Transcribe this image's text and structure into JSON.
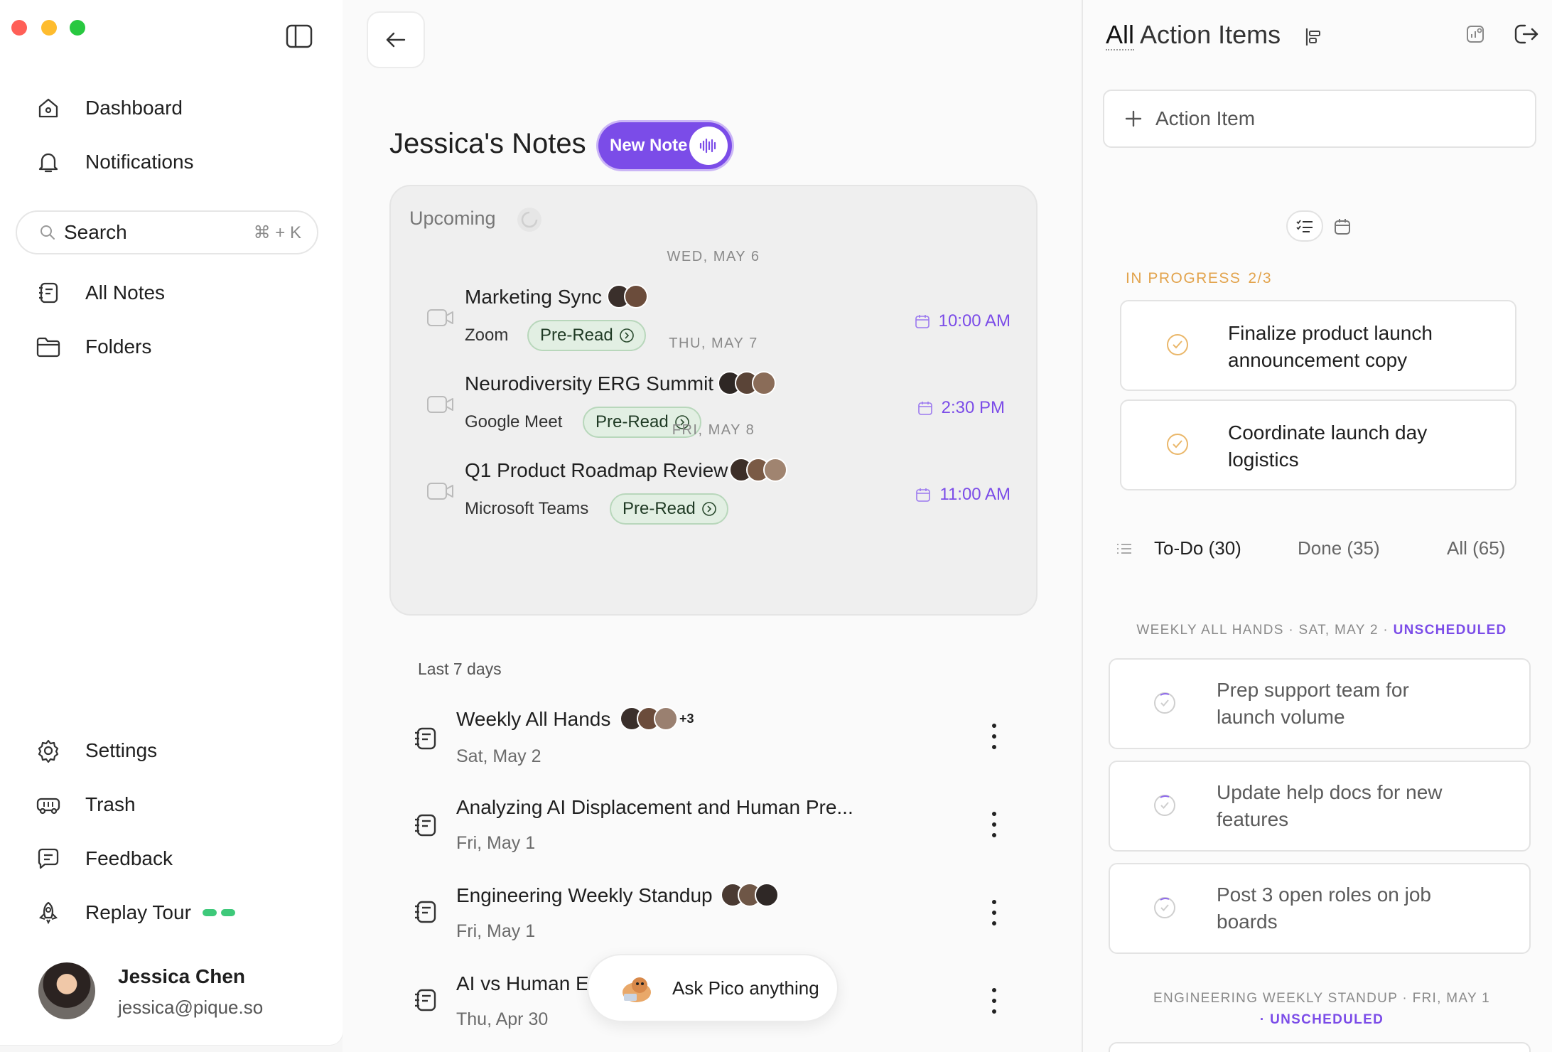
{
  "window_controls": {
    "close_color": "#ff5f57",
    "minimize_color": "#febc2e",
    "zoom_color": "#28c840"
  },
  "sidebar": {
    "nav_top": [
      {
        "label": "Dashboard",
        "icon": "home-icon"
      },
      {
        "label": "Notifications",
        "icon": "bell-icon"
      }
    ],
    "search": {
      "placeholder": "Search",
      "shortcut": "⌘ + K"
    },
    "nav_mid": [
      {
        "label": "All Notes",
        "icon": "notes-icon"
      },
      {
        "label": "Folders",
        "icon": "folder-icon"
      }
    ],
    "nav_bottom": [
      {
        "label": "Settings",
        "icon": "gear-icon"
      },
      {
        "label": "Trash",
        "icon": "trash-icon"
      },
      {
        "label": "Feedback",
        "icon": "feedback-icon"
      },
      {
        "label": "Replay Tour",
        "icon": "rocket-icon"
      }
    ],
    "user": {
      "name": "Jessica Chen",
      "email": "jessica@pique.so"
    }
  },
  "notes": {
    "title": "Jessica's Notes",
    "new_note_label": "New Note",
    "upcoming": {
      "label": "Upcoming",
      "days": [
        {
          "day": "WED, MAY 6",
          "title": "Marketing Sync",
          "platform": "Zoom",
          "preread": "Pre-Read",
          "time": "10:00 AM"
        },
        {
          "day": "THU, MAY 7",
          "title": "Neurodiversity ERG Summit",
          "platform": "Google Meet",
          "preread": "Pre-Read",
          "time": "2:30 PM"
        },
        {
          "day": "FRI, MAY 8",
          "title": "Q1 Product Roadmap Review",
          "platform": "Microsoft Teams",
          "preread": "Pre-Read",
          "time": "11:00 AM"
        }
      ]
    },
    "last7_label": "Last 7 days",
    "recent": [
      {
        "title": "Weekly All Hands",
        "date": "Sat, May 2",
        "extra_count": "+3"
      },
      {
        "title": "Analyzing AI Displacement and Human Pre...",
        "date": "Fri, May 1"
      },
      {
        "title": "Engineering Weekly Standup",
        "date": "Fri, May 1"
      },
      {
        "title": "AI vs Human E",
        "date": "Thu, Apr 30"
      }
    ],
    "ask_pico": "Ask Pico anything"
  },
  "actions": {
    "title_prefix": "All",
    "title_rest": " Action Items",
    "add_label": "Action Item",
    "in_progress": {
      "label": "IN PROGRESS",
      "count": "2/3"
    },
    "in_progress_items": [
      {
        "line1": "Finalize product launch",
        "line2": "announcement copy"
      },
      {
        "line1": "Coordinate launch day",
        "line2": "logistics"
      }
    ],
    "tabs": {
      "todo": "To-Do (30)",
      "done": "Done (35)",
      "all": "All (65)"
    },
    "group1": {
      "label": "WEEKLY ALL HANDS · SAT, MAY 2 ·",
      "status": " UNSCHEDULED"
    },
    "group1_items": [
      {
        "line1": "Prep support team for",
        "line2": "launch volume"
      },
      {
        "line1": "Update help docs for new",
        "line2": "features"
      },
      {
        "line1": "Post 3 open roles on job",
        "line2": "boards"
      }
    ],
    "group2": {
      "label": "ENGINEERING WEEKLY STANDUP · FRI, MAY 1",
      "status": "· UNSCHEDULED"
    }
  },
  "colors": {
    "accent": "#7b4ce8",
    "in_progress": "#e2a34c",
    "preread_bg": "#e2efe3",
    "tour_dots": "#3ec97a"
  }
}
